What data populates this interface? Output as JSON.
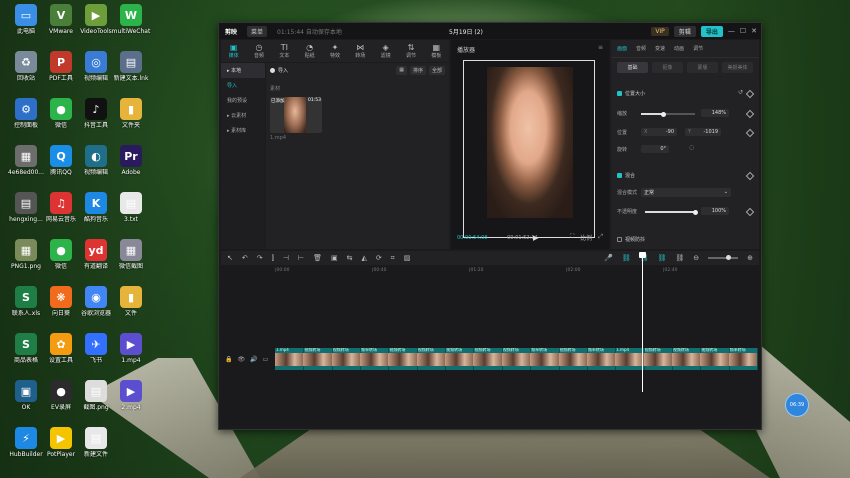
{
  "desktop": {
    "icons": [
      {
        "label": "此电脑",
        "color": "#3a8ee6",
        "glyph": "▭"
      },
      {
        "label": "VMware\nWorkstati...",
        "color": "#4a7f3a",
        "glyph": "V"
      },
      {
        "label": "VideoTools",
        "color": "#6e9d3c",
        "glyph": "▶"
      },
      {
        "label": "multiWeChat",
        "color": "#2cb34a",
        "glyph": "W"
      },
      {
        "label": "回收站",
        "color": "#7a8a9a",
        "glyph": "♻"
      },
      {
        "label": "PDF工具",
        "color": "#c0392b",
        "glyph": "P"
      },
      {
        "label": "视频编辑",
        "color": "#3a7bd5",
        "glyph": "◎"
      },
      {
        "label": "新建文本.lnk",
        "color": "#5b6e8c",
        "glyph": "▤"
      },
      {
        "label": "控制面板",
        "color": "#2e6fc9",
        "glyph": "⚙"
      },
      {
        "label": "微信",
        "color": "#2cb34a",
        "glyph": "●"
      },
      {
        "label": "抖音工具\nx64_2023",
        "color": "#111",
        "glyph": "♪"
      },
      {
        "label": "文件夹",
        "color": "#e6b43a",
        "glyph": "▮"
      },
      {
        "label": "4e68ed00...",
        "color": "#6d6d6d",
        "glyph": "▦"
      },
      {
        "label": "腾讯QQ",
        "color": "#1a8ee6",
        "glyph": "Q"
      },
      {
        "label": "视频编辑\n0128版本",
        "color": "#1f6f8b",
        "glyph": "◐"
      },
      {
        "label": "Adobe\nPremiere",
        "color": "#2a1a5e",
        "glyph": "Pr"
      },
      {
        "label": "hengxing...",
        "color": "#555",
        "glyph": "▤"
      },
      {
        "label": "网易云音乐",
        "color": "#d33",
        "glyph": "♫"
      },
      {
        "label": "酷狗音乐",
        "color": "#1e88e5",
        "glyph": "K"
      },
      {
        "label": "3.txt",
        "color": "#e8e8e8",
        "glyph": "▤"
      },
      {
        "label": "PNG1.png",
        "color": "#7a8a5a",
        "glyph": "▦"
      },
      {
        "label": "微信",
        "color": "#2cb34a",
        "glyph": "●"
      },
      {
        "label": "有道翻译",
        "color": "#d33",
        "glyph": "yd"
      },
      {
        "label": "微信截图\n20230...",
        "color": "#889",
        "glyph": "▦"
      },
      {
        "label": "联系人.xls",
        "color": "#1e7e45",
        "glyph": "S"
      },
      {
        "label": "向日葵",
        "color": "#f26b1d",
        "glyph": "❋"
      },
      {
        "label": "谷歌浏览器",
        "color": "#4285f4",
        "glyph": "◉"
      },
      {
        "label": "文件",
        "color": "#e6b43a",
        "glyph": "▮"
      },
      {
        "label": "商品表格\n明细.xlsx",
        "color": "#1e7e45",
        "glyph": "S"
      },
      {
        "label": "设置工具",
        "color": "#f39c12",
        "glyph": "✿"
      },
      {
        "label": "飞书",
        "color": "#3370ff",
        "glyph": "✈"
      },
      {
        "label": "1.mp4",
        "color": "#5b4fcf",
        "glyph": "▶"
      },
      {
        "label": "OK\nVideoMat",
        "color": "#1f5f8b",
        "glyph": "▣"
      },
      {
        "label": "EV录屏",
        "color": "#2b2b2b",
        "glyph": "●"
      },
      {
        "label": "截图.png",
        "color": "#ddd",
        "glyph": "▤"
      },
      {
        "label": "2.mp4",
        "color": "#5b4fcf",
        "glyph": "▶"
      },
      {
        "label": "HubBuilder",
        "color": "#1e88e5",
        "glyph": "⚡"
      },
      {
        "label": "PotPlayer",
        "color": "#f5c400",
        "glyph": "▶"
      },
      {
        "label": "新建文件\n夹.zip",
        "color": "#e8e8e8",
        "glyph": "▤"
      }
    ]
  },
  "app": {
    "name": "剪映",
    "menu": "菜单",
    "status": "01:15:44 自动保存本地",
    "project_title": "5月19日 (2)",
    "vip": "VIP",
    "share": "剪辑",
    "export": "导出"
  },
  "media_toolbar": [
    {
      "label": "媒体",
      "icon": "▣",
      "active": true
    },
    {
      "label": "音频",
      "icon": "◷"
    },
    {
      "label": "文本",
      "icon": "TI"
    },
    {
      "label": "贴纸",
      "icon": "◔"
    },
    {
      "label": "特效",
      "icon": "✦"
    },
    {
      "label": "转场",
      "icon": "⋈"
    },
    {
      "label": "滤镜",
      "icon": "◈"
    },
    {
      "label": "调节",
      "icon": "⇅"
    },
    {
      "label": "模板",
      "icon": "▦"
    }
  ],
  "sidebar": {
    "items": [
      "本地",
      "导入",
      "我的预设",
      "云素材",
      "素材库"
    ]
  },
  "media": {
    "import_label": "导入",
    "view_label": "▦",
    "sort_label": "排序",
    "filter_label": "全部",
    "section_label": "素材",
    "clip": {
      "badge": "已添加",
      "duration": "01:53",
      "name": "1.mp4"
    }
  },
  "player": {
    "title": "播放器",
    "current_time": "00:00:54:08",
    "total_time": "00:01:52:14",
    "ratio": "比例"
  },
  "props": {
    "tabs": [
      "画面",
      "音频",
      "变速",
      "动画",
      "调节"
    ],
    "subtabs": [
      "基础",
      "抠像",
      "蒙版",
      "美颜美体"
    ],
    "position_size": "位置大小",
    "scale_label": "缩放",
    "scale_value": "148%",
    "scale_fraction": 0.41,
    "position_label": "位置",
    "pos_x_label": "X",
    "pos_x": "-90",
    "pos_y_label": "Y",
    "pos_y": "-1019",
    "rotate_label": "旋转",
    "rotate_value": "0°",
    "blend": "混合",
    "blend_mode_label": "混合模式",
    "blend_mode": "正常",
    "opacity_label": "不透明度",
    "opacity_value": "100%",
    "opacity_fraction": 1.0,
    "stabilize": "视频防抖"
  },
  "timeline": {
    "ruler": [
      "|00:00",
      "|00:40",
      "|01:20",
      "|02:00",
      "|02:40"
    ],
    "clips": [
      "1.mp4",
      "视频转场",
      "视频转场",
      "频率转场",
      "视频转场",
      "视频转场",
      "视频转场",
      "视频转场",
      "视频转场",
      "频率转场",
      "视频转场",
      "频率转场",
      "1.mp4",
      "视频转场",
      "视频转场",
      "视频转场",
      "频率转场"
    ],
    "badge_time": "06:39"
  }
}
